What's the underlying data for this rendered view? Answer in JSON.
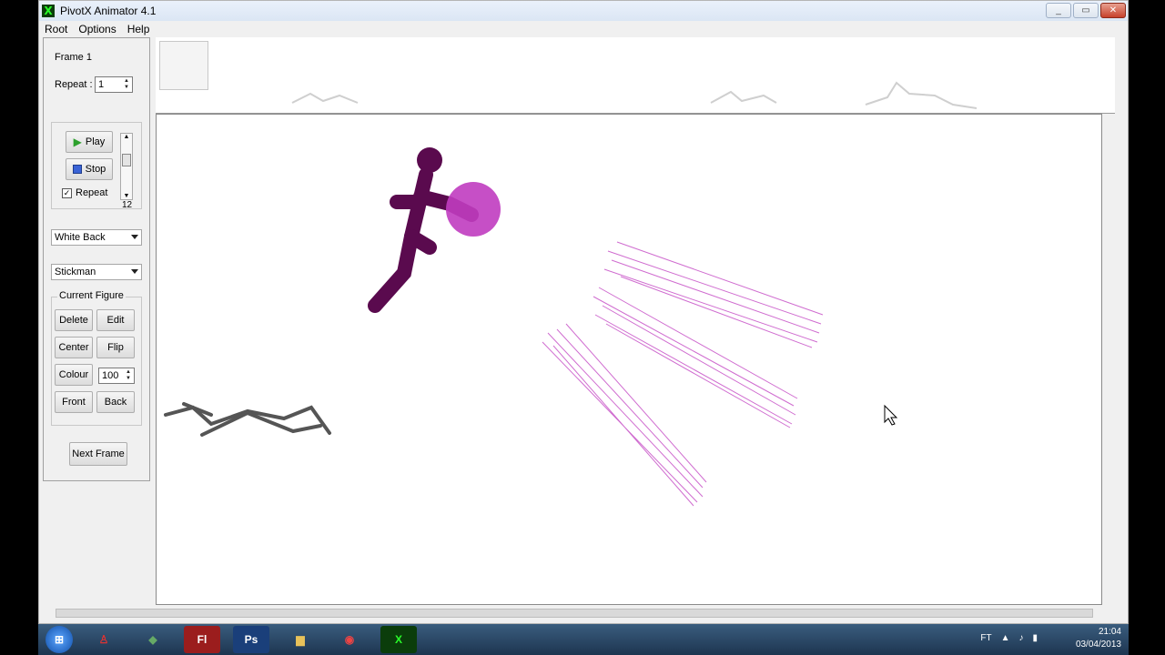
{
  "window": {
    "title": "PivotX Animator 4.1",
    "icon": "X"
  },
  "menu": [
    "Root",
    "Options",
    "Help"
  ],
  "left_panel": {
    "frame_label": "Frame 1",
    "repeat_label": "Repeat :",
    "repeat_value": "1",
    "play_label": "Play",
    "stop_label": "Stop",
    "repeat_check_label": "Repeat",
    "speed_value": "12",
    "background_select": "White Back",
    "figure_select": "Stickman",
    "current_figure_label": "Current Figure",
    "delete_label": "Delete",
    "edit_label": "Edit",
    "center_label": "Center",
    "flip_label": "Flip",
    "colour_label": "Colour",
    "colour_value": "100",
    "front_label": "Front",
    "back_label": "Back",
    "next_frame_label": "Next Frame"
  },
  "taskbar": {
    "apps": [
      "Fl",
      "Ps"
    ],
    "tray_text": "FT",
    "time": "21:04",
    "date": "03/04/2013"
  },
  "colors": {
    "figure": "#5a0a4e",
    "energy": "#c03cc0",
    "debris": "#555555"
  }
}
